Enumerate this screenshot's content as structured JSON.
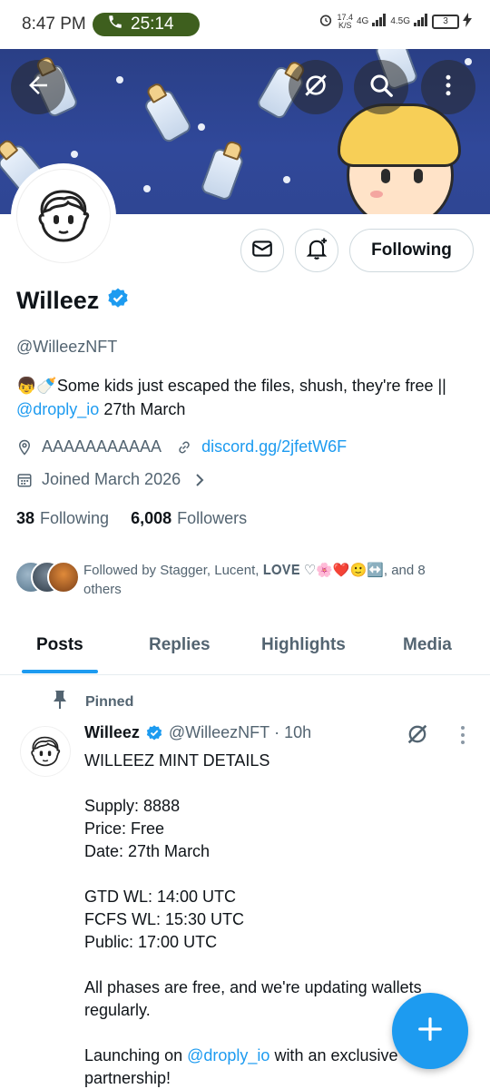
{
  "status_bar": {
    "time": "8:47 PM",
    "call_timer": "25:14",
    "speed_value": "17.4",
    "speed_unit": "K/S",
    "net1": "4G",
    "net2": "4.5G",
    "battery": "3"
  },
  "profile": {
    "name": "Willeez",
    "handle": "@WilleezNFT",
    "bio_text": "👦🍼Some kids just escaped the files, shush, they're free || ",
    "bio_link": "@droply_io",
    "bio_tail": " 27th March",
    "location": "AAAAAAAAAAA",
    "website": "discord.gg/2jfetW6F",
    "joined": "Joined March 2026",
    "following_count": "38",
    "following_label": "Following",
    "followers_count": "6,008",
    "followers_label": "Followers",
    "followed_by": "Followed by Stagger, Lucent, 𝐋𝐎𝐕𝐄 ♡🌸❤️🙂↔️, and 8 others",
    "follow_button": "Following"
  },
  "tabs": [
    {
      "label": "Posts",
      "active": true
    },
    {
      "label": "Replies",
      "active": false
    },
    {
      "label": "Highlights",
      "active": false
    },
    {
      "label": "Media",
      "active": false
    }
  ],
  "post": {
    "pinned_label": "Pinned",
    "author_name": "Willeez",
    "author_handle": "@WilleezNFT",
    "separator": "·",
    "time": "10h",
    "body_1": "WILLEEZ MINT DETAILS\n\nSupply: 8888\nPrice: Free\nDate: 27th March\n\nGTD WL: 14:00 UTC\nFCFS WL: 15:30 UTC\nPublic: 17:00 UTC\n\nAll phases are free, and we're updating wallets regularly.\n\nLaunching on ",
    "body_link": "@droply_io",
    "body_2": " with an exclusive partnership!"
  },
  "colors": {
    "accent": "#1d9bf0",
    "banner": "#2f4693",
    "call_pill": "#3e5f1e",
    "secondary_text": "#536471"
  },
  "icons": [
    "back-arrow-icon",
    "grok-icon",
    "search-icon",
    "more-vertical-icon",
    "message-icon",
    "notification-bell-icon",
    "verified-badge-icon",
    "location-icon",
    "link-icon",
    "calendar-icon",
    "chevron-right-icon",
    "pin-icon",
    "compose-plus-icon",
    "phone-icon",
    "alarm-icon"
  ]
}
